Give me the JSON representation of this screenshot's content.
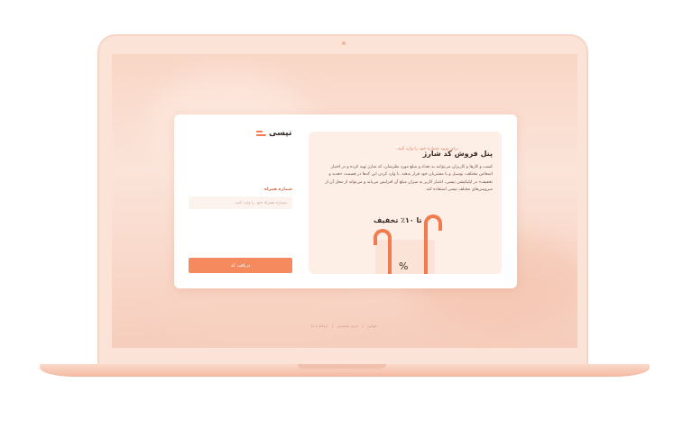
{
  "brand": {
    "name": "تپسی"
  },
  "login": {
    "subtitle": "برای ورود شماره خود را وارد کنید.",
    "phone_label": "شماره همراه",
    "phone_placeholder": "شماره همراه خود را وارد کنید.",
    "submit_label": "دریافت کد"
  },
  "promo": {
    "title": "پنل فروش کد شارژ",
    "description": "کسب‌ و کارها و کاربران می‌توانند به تعداد و مبلغ مورد نظرشان، کد شارژ تهیه کرده و در اختیار اشخاص مختلف، بوسیل و یا مشتریان خود قرار بدهند. با وارد کردن این کدها در قسمت «هدیه و تخفیف» در اپلیکیشن تپسی، اعتبار کاربر به میزان مبلغ آن افزایش می‌یابد و می‌تواند از محل آن از سرویس‌های مختلف تپسی استفاده کند.",
    "discount": "تا ۱۰٪ تخفیف",
    "percent_symbol": "%"
  },
  "footer": {
    "items": [
      "قوانین",
      "حریم خصوصی",
      "ارتباط با ما"
    ]
  },
  "colors": {
    "accent": "#f58a5f",
    "lid": "#fbe3d7",
    "card": "#ffffff",
    "promo_bg": "#fdeee6"
  }
}
